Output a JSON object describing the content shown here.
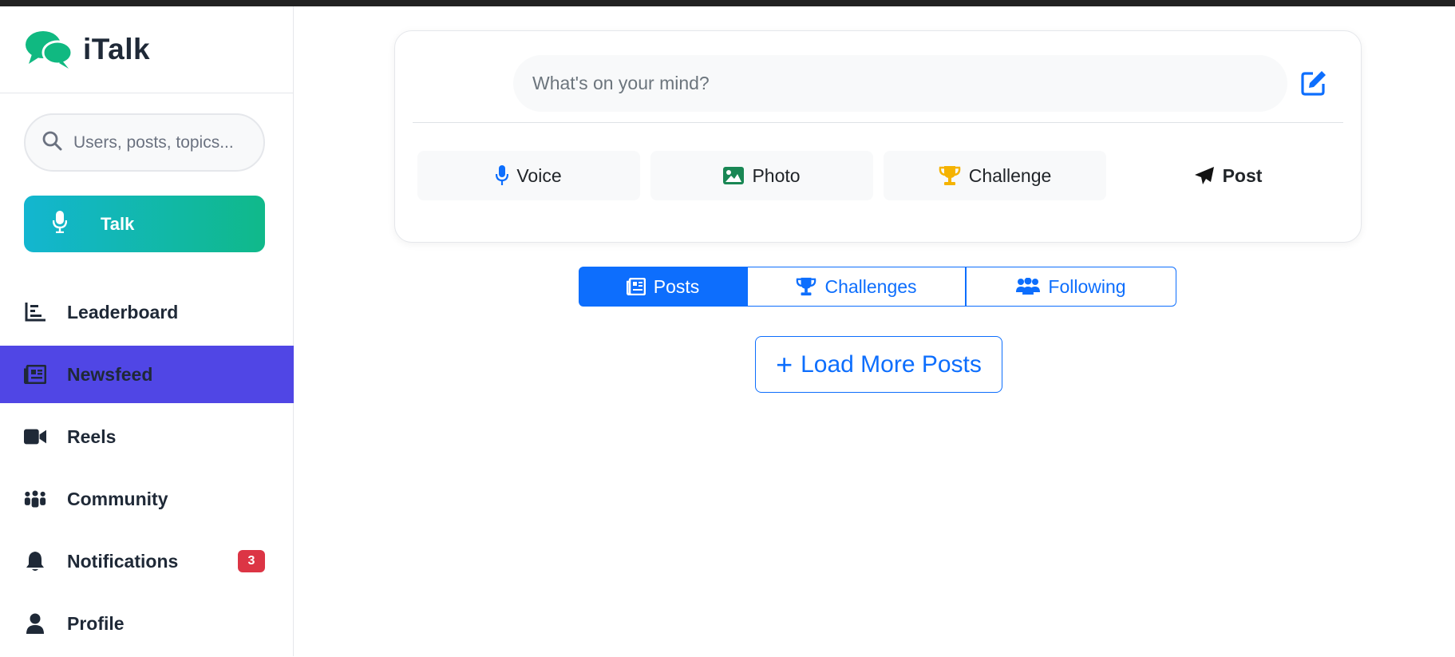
{
  "app": {
    "name": "iTalk"
  },
  "search": {
    "placeholder": "Users, posts, topics..."
  },
  "talk_button": {
    "label": "Talk"
  },
  "nav": {
    "items": [
      {
        "label": "Leaderboard",
        "icon": "chart-bar-icon"
      },
      {
        "label": "Newsfeed",
        "icon": "newspaper-icon",
        "active": true
      },
      {
        "label": "Reels",
        "icon": "video-camera-icon"
      },
      {
        "label": "Community",
        "icon": "people-group-icon"
      },
      {
        "label": "Notifications",
        "icon": "bell-icon",
        "badge": "3"
      },
      {
        "label": "Profile",
        "icon": "user-icon"
      }
    ]
  },
  "composer": {
    "placeholder": "What's on your mind?",
    "actions": {
      "voice": "Voice",
      "photo": "Photo",
      "challenge": "Challenge",
      "post": "Post"
    }
  },
  "feed_tabs": {
    "posts": "Posts",
    "challenges": "Challenges",
    "following": "Following"
  },
  "load_more": {
    "label": "Load More Posts"
  },
  "colors": {
    "brand_green": "#10b981",
    "active_nav": "#5046e5",
    "primary_blue": "#0d6efd",
    "badge_red": "#dc3545",
    "trophy_gold": "#f5b301",
    "photo_green": "#198754"
  }
}
